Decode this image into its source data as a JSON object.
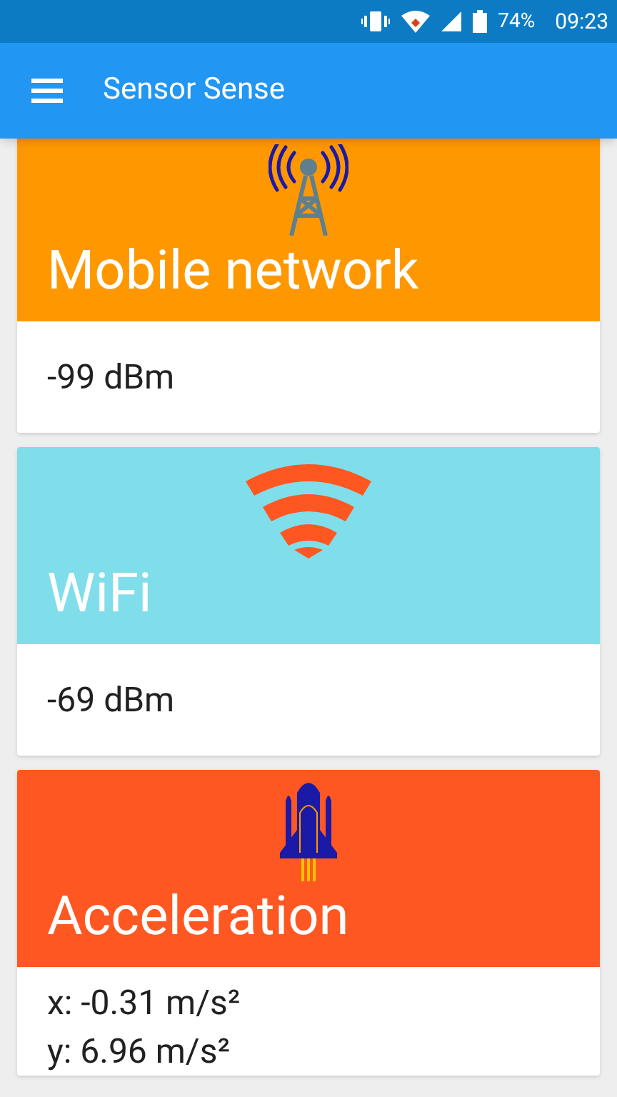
{
  "status_bar": {
    "battery": "74%",
    "time": "09:23"
  },
  "app_bar": {
    "title": "Sensor Sense"
  },
  "cards": [
    {
      "kind": "tower",
      "color": "#ff9800",
      "title": "Mobile network",
      "lines": [
        "-99 dBm"
      ]
    },
    {
      "kind": "wifi",
      "color": "#80deea",
      "title": "WiFi",
      "lines": [
        "-69 dBm"
      ]
    },
    {
      "kind": "rocket",
      "color": "#ff5722",
      "title": "Acceleration",
      "lines": [
        "x: -0.31 m/s²",
        "y: 6.96 m/s²"
      ]
    }
  ]
}
